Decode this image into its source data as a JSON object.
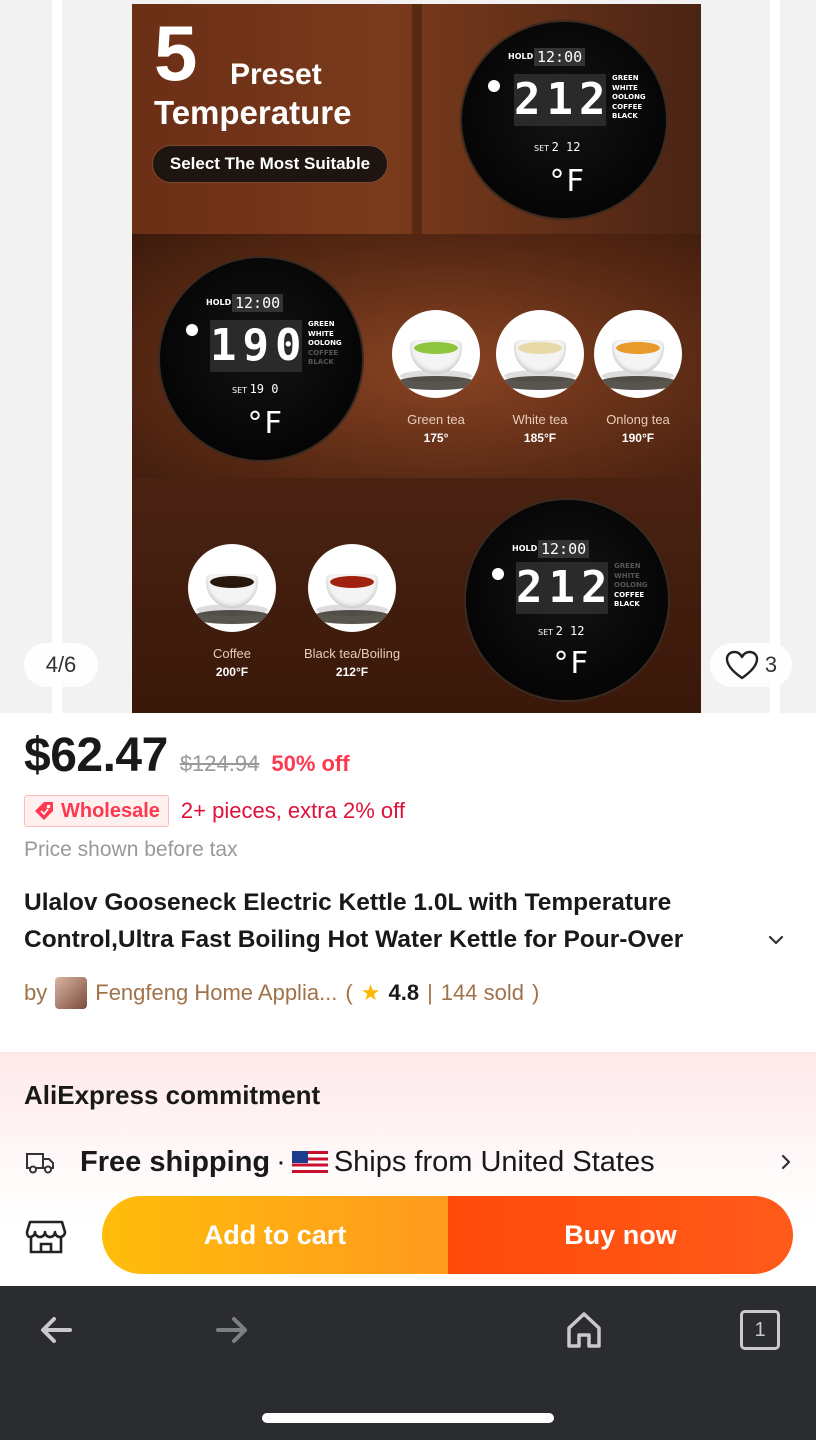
{
  "gallery": {
    "counter": "4/6",
    "likes": "3",
    "image": {
      "headline_number": "5",
      "headline_word1": "Preset",
      "headline_word2": "Temperature",
      "pill": "Select The Most Suitable",
      "dial_top": {
        "hold": "HOLD",
        "clock": "12:00",
        "temp": "212",
        "set_label": "SET",
        "set_value": "2 12",
        "unit": "°F",
        "modes": [
          "GREEN",
          "WHITE",
          "OOLONG",
          "COFFEE",
          "BLACK"
        ]
      },
      "dial_mid": {
        "hold": "HOLD",
        "clock": "12:00",
        "temp": "190",
        "set_label": "SET",
        "set_value": "19 0",
        "unit": "°F",
        "modes": [
          "GREEN",
          "WHITE",
          "OOLONG",
          "COFFEE",
          "BLACK"
        ]
      },
      "dial_bottom": {
        "hold": "HOLD",
        "clock": "12:00",
        "temp": "212",
        "set_label": "SET",
        "set_value": "2 12",
        "unit": "°F",
        "modes": [
          "GREEN",
          "WHITE",
          "OOLONG",
          "COFFEE",
          "BLACK"
        ]
      },
      "teas": [
        {
          "name": "Green tea",
          "temp": "175°",
          "liquid": "#8ec63f"
        },
        {
          "name": "White tea",
          "temp": "185°F",
          "liquid": "#e8d9a8"
        },
        {
          "name": "Onlong  tea",
          "temp": "190°F",
          "liquid": "#e89a2a"
        },
        {
          "name": "Coffee",
          "temp": "200°F",
          "liquid": "#2a170c"
        },
        {
          "name": "Black tea/Boiling",
          "temp": "212°F",
          "liquid": "#a0210f"
        }
      ]
    }
  },
  "price": {
    "current": "$62.47",
    "original": "$124.94",
    "discount": "50% off"
  },
  "wholesale": {
    "badge": "Wholesale",
    "text": "2+ pieces, extra 2% off"
  },
  "tax_note": "Price shown before tax",
  "product_title": "Ulalov Gooseneck Electric Kettle 1.0L with Temperature Control,Ultra Fast Boiling Hot Water Kettle for Pour-Over",
  "seller": {
    "by": "by",
    "name": "Fengfeng Home Applia...",
    "open": "(",
    "rating": "4.8",
    "sep": "|",
    "sold": "144 sold",
    "close": ")"
  },
  "commitment": {
    "title": "AliExpress commitment",
    "shipping": "Free shipping",
    "dot": "·",
    "ships_from": "Ships from United States"
  },
  "actions": {
    "add_to_cart": "Add to cart",
    "buy_now": "Buy now"
  },
  "browser": {
    "tabs_count": "1"
  },
  "colors": {
    "accent_red": "#fd384f",
    "cart_orange": "#ffbd0a",
    "buy_red": "#ff4b0a",
    "seller_brown": "#a0724a"
  }
}
